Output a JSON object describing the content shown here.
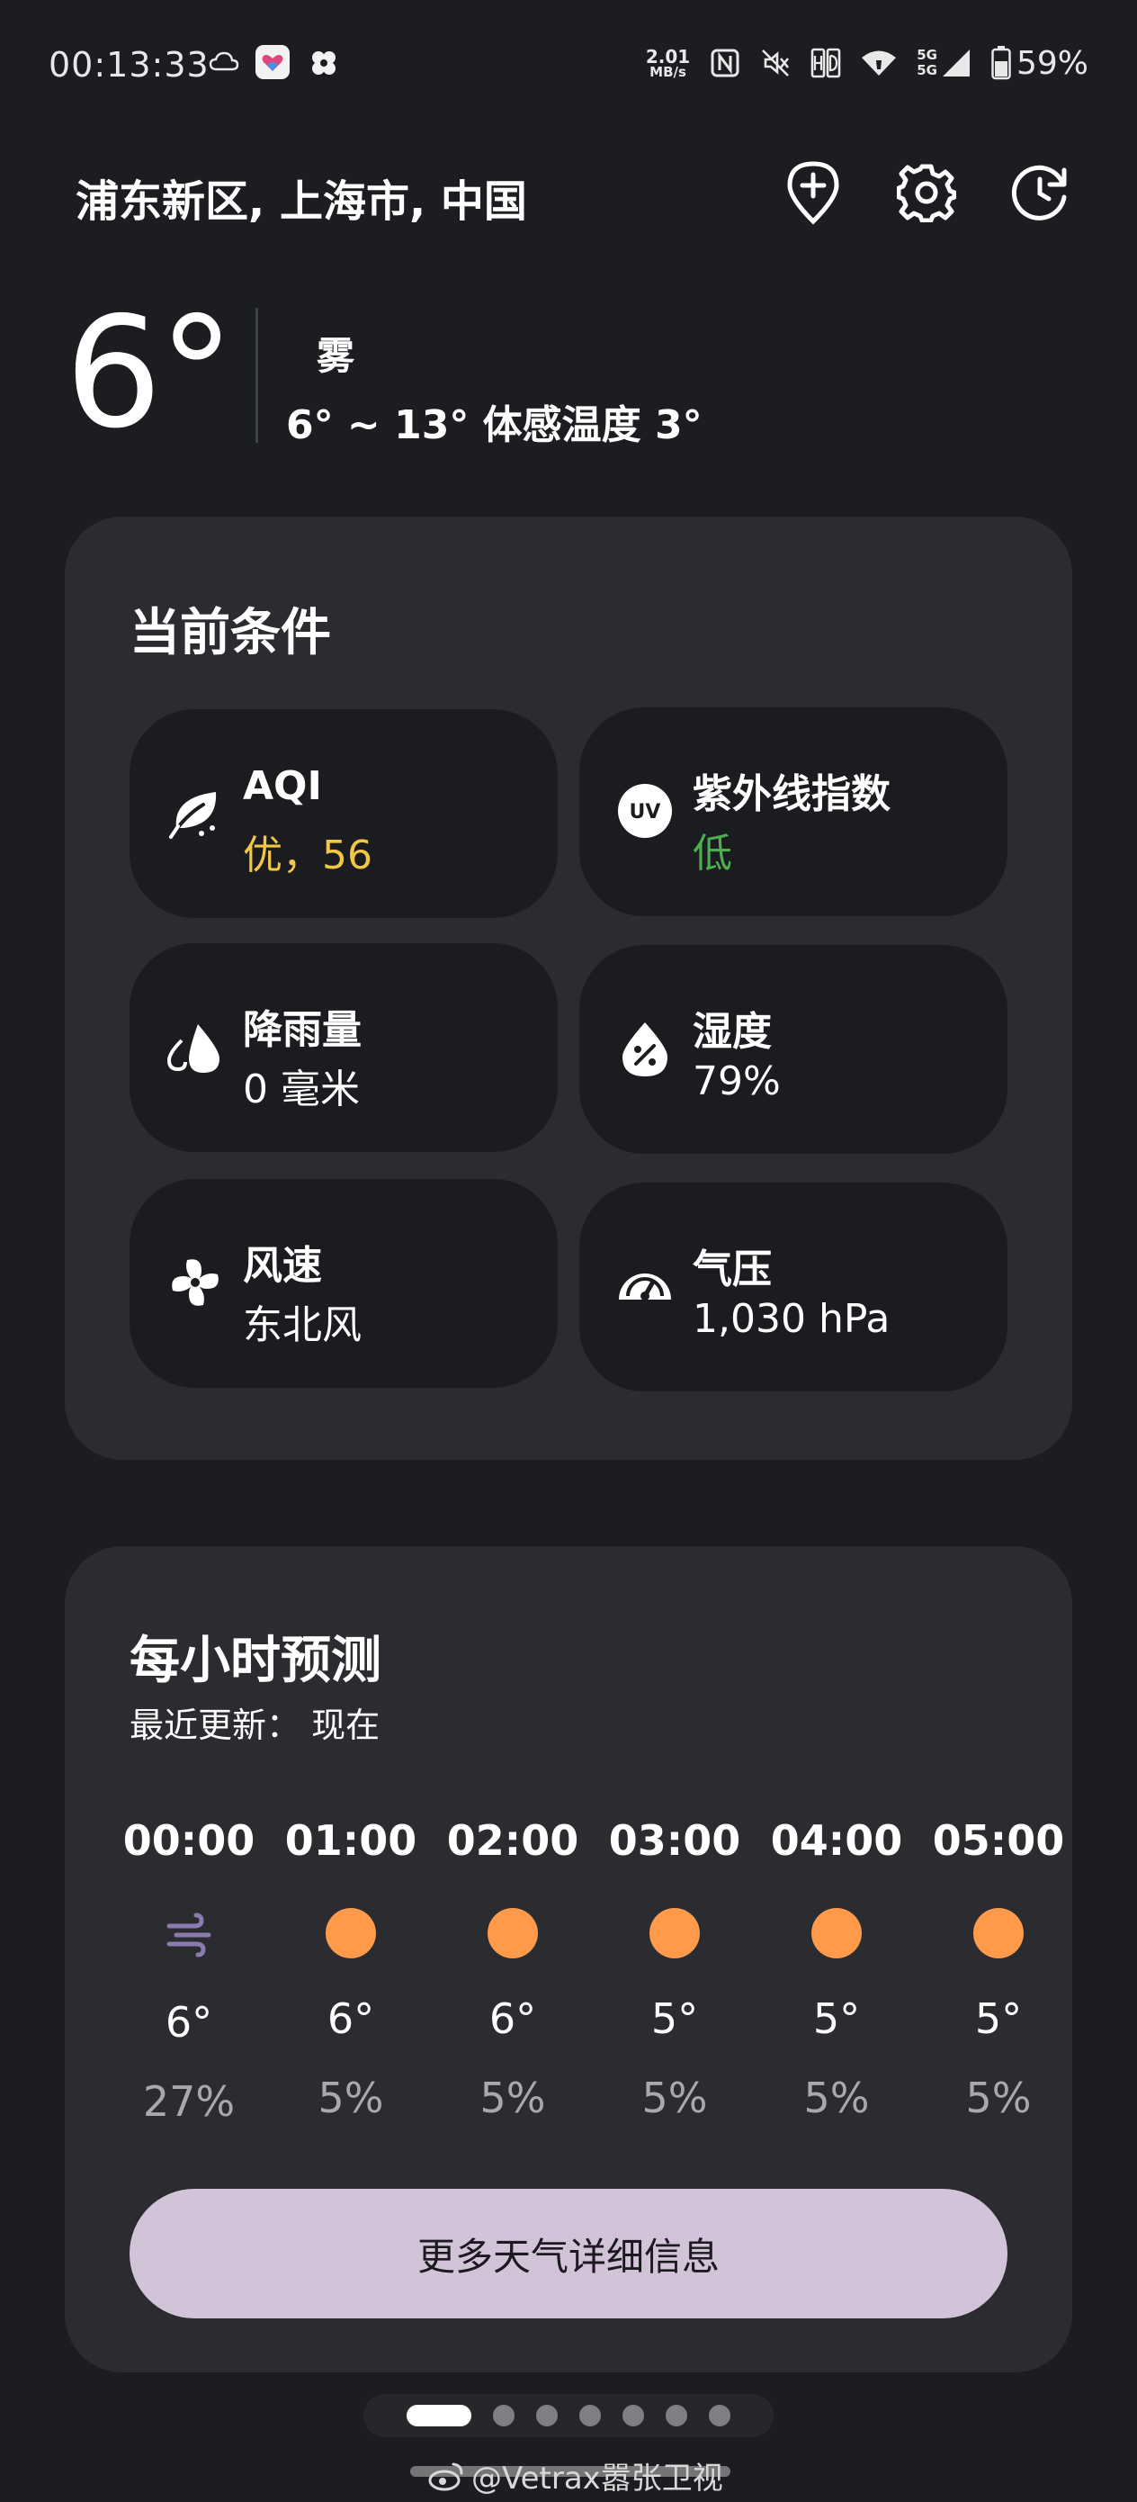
{
  "status_bar": {
    "time": "00:13:33",
    "net_speed_value": "2.01",
    "net_speed_unit": "MB/s",
    "signal_label_1": "5G",
    "signal_label_2": "5G",
    "battery": "59%",
    "battery_level": 0.59,
    "icons": [
      "cloud-icon",
      "app-heart-icon",
      "app-clover-icon",
      "nfc-icon",
      "mute-icon",
      "hd-icon",
      "wifi-icon",
      "cell-signal-icon",
      "battery-icon"
    ]
  },
  "header": {
    "location": "浦东新区, 上海市, 中国",
    "buttons": [
      "add-location-icon",
      "settings-icon",
      "history-icon"
    ]
  },
  "current": {
    "temp": "6°",
    "condition": "雾",
    "range_feels": "6° ~ 13° 体感温度 3°"
  },
  "conditions": {
    "title": "当前条件",
    "tiles": [
      {
        "label": "AQI",
        "value": "优，56",
        "value_color": "#f2c744",
        "icon": "leaf-icon"
      },
      {
        "label": "紫外线指数",
        "value": "低",
        "value_color": "#4caf50",
        "icon": "uv-icon"
      },
      {
        "label": "降雨量",
        "value": "0 毫米",
        "value_color": "#ffffff",
        "icon": "raindrop-icon"
      },
      {
        "label": "湿度",
        "value": "79%",
        "value_color": "#ffffff",
        "icon": "humidity-icon"
      },
      {
        "label": "风速",
        "value": "东北风",
        "value_color": "#ffffff",
        "icon": "fan-icon"
      },
      {
        "label": "气压",
        "value": "1,030 hPa",
        "value_color": "#ffffff",
        "icon": "gauge-icon"
      }
    ]
  },
  "hourly": {
    "title": "每小时预测",
    "updated": "最近更新：  现在",
    "hours": [
      {
        "time": "00:00",
        "icon": "fog-icon",
        "temp": "6°",
        "precip": "27%"
      },
      {
        "time": "01:00",
        "icon": "sun-icon",
        "temp": "6°",
        "precip": "5%"
      },
      {
        "time": "02:00",
        "icon": "sun-icon",
        "temp": "6°",
        "precip": "5%"
      },
      {
        "time": "03:00",
        "icon": "sun-icon",
        "temp": "5°",
        "precip": "5%"
      },
      {
        "time": "04:00",
        "icon": "sun-icon",
        "temp": "5°",
        "precip": "5%"
      },
      {
        "time": "05:00",
        "icon": "sun-icon",
        "temp": "5°",
        "precip": "5%"
      }
    ],
    "more_button": "更多天气详细信息"
  },
  "pager": {
    "pages": 7,
    "active": 0
  },
  "watermark": "@Vetrax嚣张卫视",
  "colors": {
    "background": "#1b1d20",
    "card": "#2a2c30",
    "tile": "#1b1c1f",
    "sun": "#ff9a4a",
    "fog": "#8b7bb0",
    "button": "#d2c3d9"
  }
}
